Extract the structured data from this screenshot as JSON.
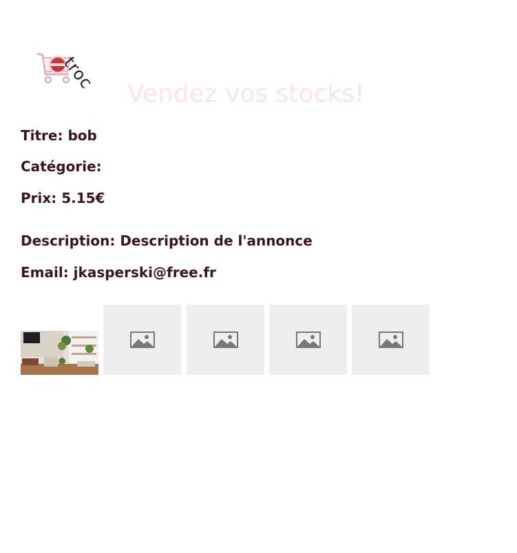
{
  "header": {
    "logo_text": "troc",
    "tagline": "Vendez vos stocks!"
  },
  "listing": {
    "title": "Titre: bob",
    "category": "Catégorie:",
    "price": "Prix: 5.15€",
    "description": "Description: Description de l'annonce",
    "email": "Email: jkasperski@free.fr"
  },
  "colors": {
    "field_text": "#3a1521",
    "tagline": "#fbe4e4",
    "placeholder_bg": "#eeeeee",
    "placeholder_icon": "#777777",
    "logo_accent": "#c0393b"
  },
  "images": {
    "main": "room-photo",
    "placeholders": [
      "image-placeholder-icon",
      "image-placeholder-icon",
      "image-placeholder-icon",
      "image-placeholder-icon"
    ]
  }
}
